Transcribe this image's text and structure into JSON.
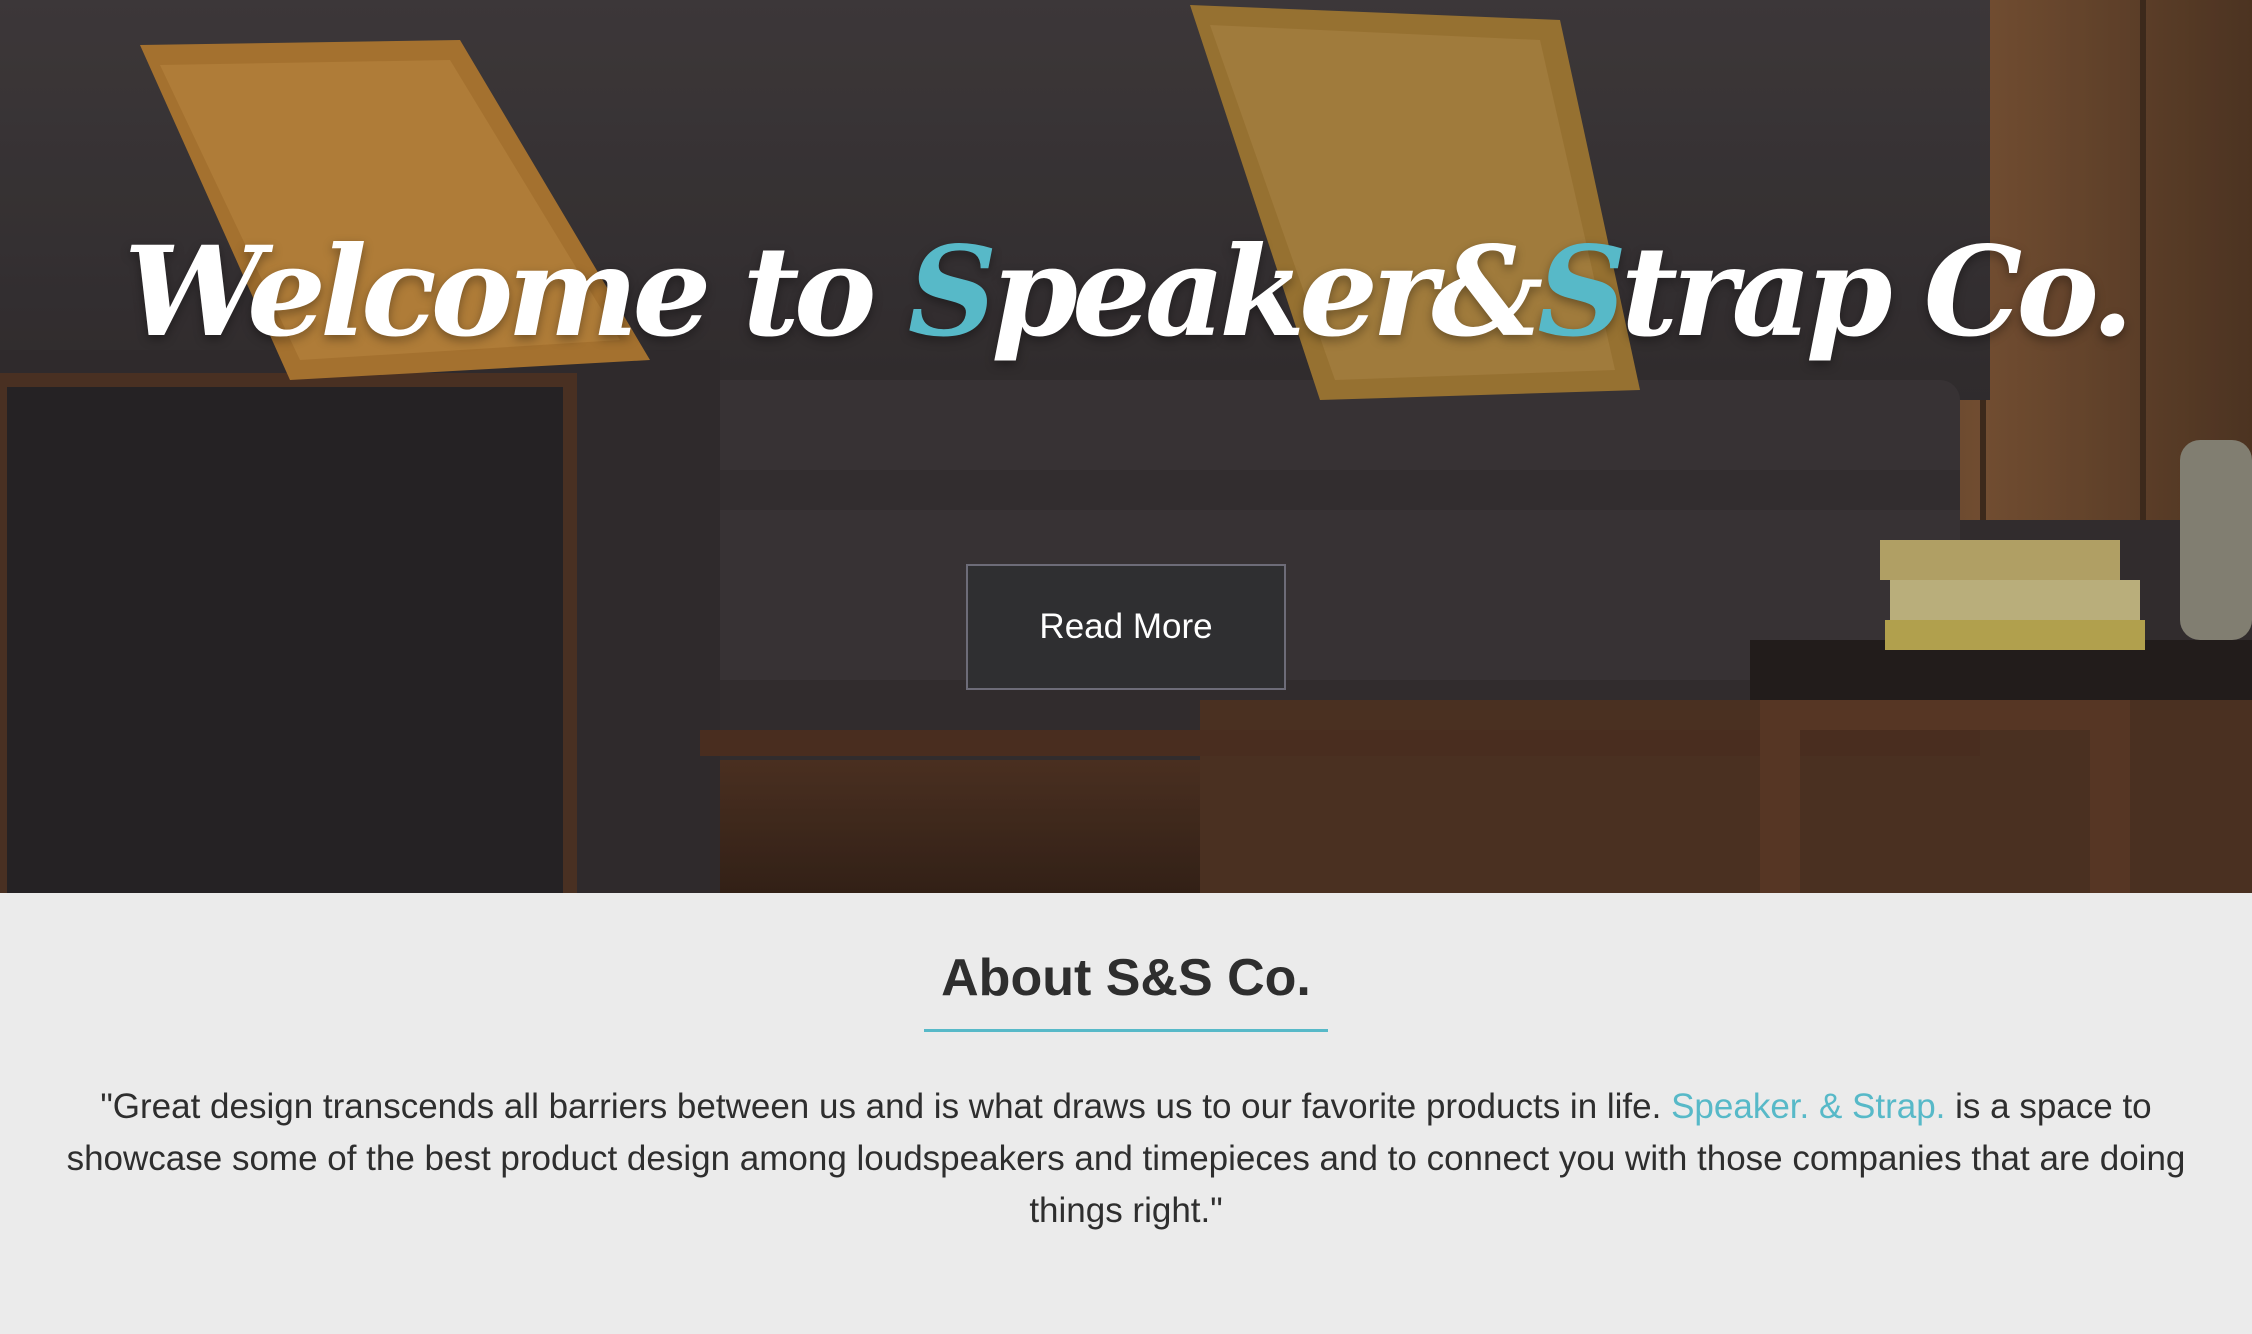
{
  "hero": {
    "title_part1": "Welcome to ",
    "title_s1": "S",
    "title_part2": "peaker&",
    "title_s2": "S",
    "title_part3": "trap Co.",
    "read_more_label": "Read More",
    "accent_color": "#57b9c8"
  },
  "about": {
    "title": "About S&S Co.",
    "text_before": "\"Great design transcends all barriers between us and is what draws us to our favorite products in life. ",
    "link_text": "Speaker. & Strap.",
    "text_after": " is a space to showcase some of the best product design among loudspeakers and timepieces and to connect you with those companies that are doing things right.\""
  }
}
